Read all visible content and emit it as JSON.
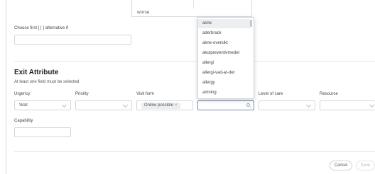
{
  "top": {
    "text_fragment": "worse."
  },
  "choose_first": {
    "label": "Choose first [ | ] alternative if",
    "value": ""
  },
  "exit_attribute": {
    "title": "Exit Attribute",
    "subtitle": "At least one field must be selected",
    "fields": {
      "urgency": {
        "label": "Urgency",
        "value": "Wait"
      },
      "priority": {
        "label": "Priority",
        "value": ""
      },
      "visit_form": {
        "label": "Visit form",
        "chip": "Online possible",
        "chip_remove": "×"
      },
      "diagnosis": {
        "label": "",
        "value": ""
      },
      "level_of_care": {
        "label": "Level of care",
        "value": ""
      },
      "resource": {
        "label": "Resource",
        "value": ""
      },
      "capability": {
        "label": "Capability",
        "value": ""
      }
    }
  },
  "dropdown": {
    "options": [
      "acne",
      "aderbrack",
      "akne-oversikt",
      "akutpreventivmedel",
      "allergi",
      "allergi-vad-ar-det",
      "allergy",
      "amning"
    ],
    "highlighted_index": 0
  },
  "footer": {
    "cancel_label": "Cancel",
    "save_label": "Save"
  }
}
